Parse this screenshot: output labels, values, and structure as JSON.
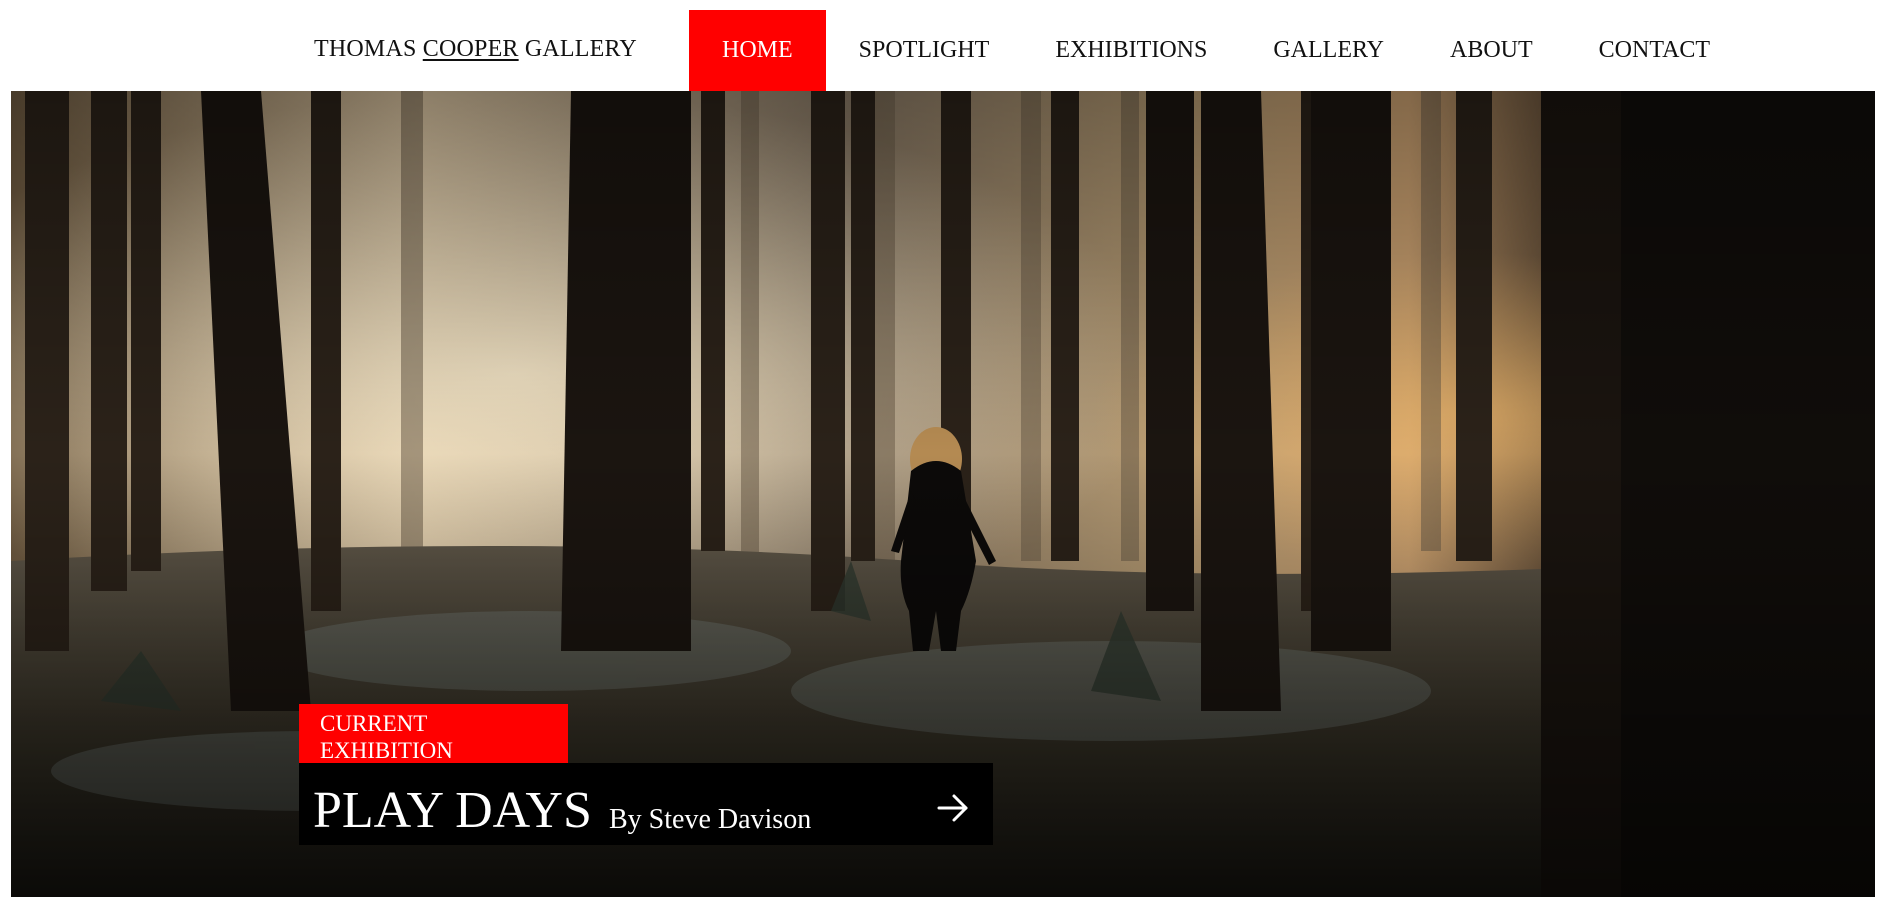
{
  "nav": {
    "brand_prefix": "THOMAS",
    "brand_underlined": "COOPER",
    "brand_suffix": "GALLERY",
    "items": [
      {
        "label": "HOME",
        "active": true
      },
      {
        "label": "SPOTLIGHT",
        "active": false
      },
      {
        "label": "EXHIBITIONS",
        "active": false
      },
      {
        "label": "GALLERY",
        "active": false
      },
      {
        "label": "ABOUT",
        "active": false
      },
      {
        "label": "CONTACT",
        "active": false
      }
    ]
  },
  "hero": {
    "badge_line1": "CURRENT",
    "badge_line2": "EXHIBITION",
    "title": "PLAY DAYS",
    "artist": "By Steve Davison",
    "arrow_icon": "arrow-right-icon"
  },
  "colors": {
    "accent": "#ff0000",
    "card": "#000000",
    "text": "#111111"
  }
}
